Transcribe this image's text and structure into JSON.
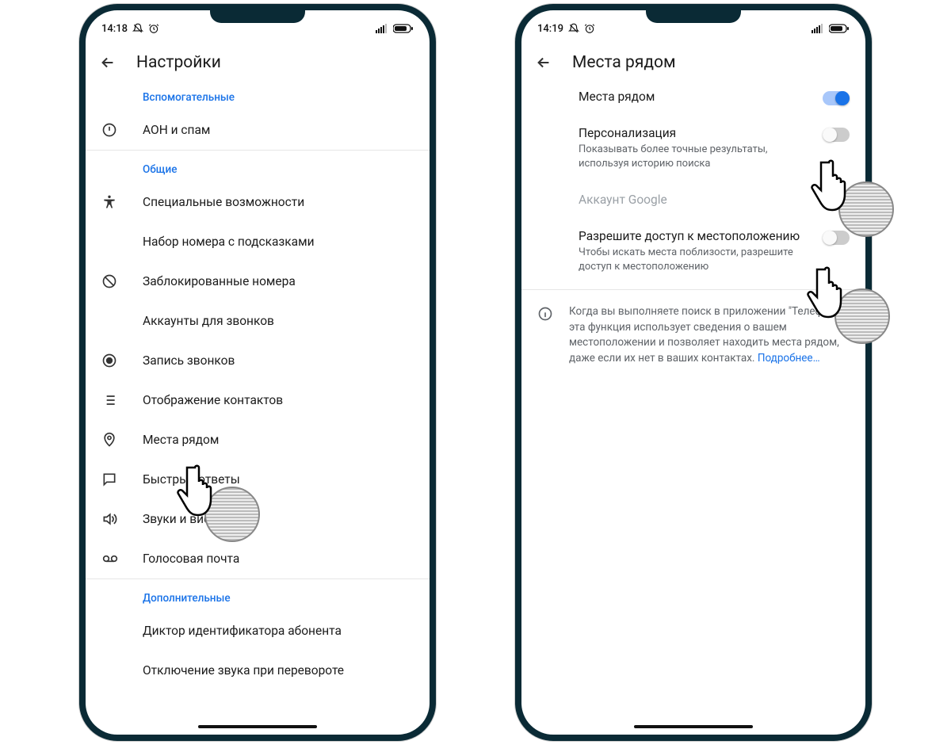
{
  "left": {
    "status_time": "14:18",
    "title": "Настройки",
    "sections": [
      {
        "label": "Вспомогательные",
        "items": [
          {
            "icon": "alert-circle-icon",
            "label": "АОН и спам"
          }
        ]
      },
      {
        "label": "Общие",
        "items": [
          {
            "icon": "accessibility-icon",
            "label": "Специальные возможности"
          },
          {
            "icon": "",
            "label": "Набор номера с подсказками"
          },
          {
            "icon": "block-icon",
            "label": "Заблокированные номера"
          },
          {
            "icon": "",
            "label": "Аккаунты для звонков"
          },
          {
            "icon": "record-icon",
            "label": "Запись звонков"
          },
          {
            "icon": "list-icon",
            "label": "Отображение контактов"
          },
          {
            "icon": "pin-icon",
            "label": "Места рядом"
          },
          {
            "icon": "speech-bubble-icon",
            "label": "Быстрые ответы"
          },
          {
            "icon": "volume-icon",
            "label": "Звуки и вибрация"
          },
          {
            "icon": "voicemail-icon",
            "label": "Голосовая почта"
          }
        ]
      },
      {
        "label": "Дополнительные",
        "items": [
          {
            "icon": "",
            "label": "Диктор идентификатора абонента"
          },
          {
            "icon": "",
            "label": "Отключение звука при перевороте"
          }
        ]
      }
    ]
  },
  "right": {
    "status_time": "14:19",
    "title": "Места рядом",
    "toggle_main": {
      "title": "Места рядом",
      "on": true
    },
    "toggle_personalization": {
      "title": "Персонализация",
      "sub": "Показывать более точные результаты, используя историю поиска",
      "on": false
    },
    "account_label": "Аккаунт Google",
    "toggle_location": {
      "title": "Разрешите доступ к местоположению",
      "sub": "Чтобы искать места поблизости, разрешите доступ к местоположению",
      "on": false
    },
    "info_text": "Когда вы выполняете поиск в приложении \"Телефон\", эта функция использует сведения о вашем местоположении и позволяет находить места рядом, даже если их нет в ваших контактах. ",
    "info_link": "Подробнее…"
  }
}
